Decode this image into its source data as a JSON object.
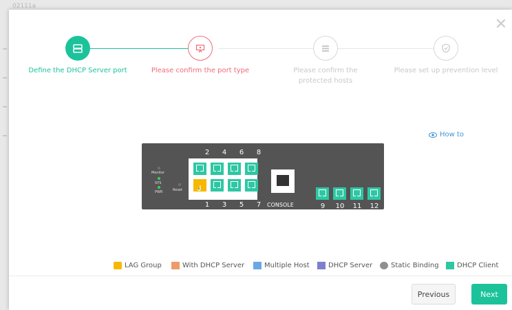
{
  "background": {
    "header_text": "02111a"
  },
  "steps": [
    {
      "label": "Define the DHCP Server port",
      "state": "done",
      "icon": "server-icon"
    },
    {
      "label": "Please confirm the port type",
      "state": "current",
      "icon": "monitor-icon"
    },
    {
      "label": "Please confirm the protected hosts",
      "state": "todo",
      "icon": "list-icon"
    },
    {
      "label": "Please set up prevention level",
      "state": "todo",
      "icon": "shield-icon"
    }
  ],
  "how_to": {
    "label": "How to",
    "icon": "eye-icon"
  },
  "device": {
    "led_labels": {
      "monitor": "Monitor",
      "sys": "SYS",
      "pwr": "PWR",
      "reset": "Reset"
    },
    "top_port_labels": [
      "2",
      "4",
      "6",
      "8"
    ],
    "bottom_port_labels": [
      "1",
      "3",
      "5",
      "7"
    ],
    "console_label": "CONSOLE",
    "sfp_port_labels": [
      "9",
      "10",
      "11",
      "12"
    ],
    "lag_port": "1"
  },
  "legend": [
    {
      "label": "LAG Group",
      "color": "#f7b800"
    },
    {
      "label": "With DHCP Server",
      "color": "#ef9a6a"
    },
    {
      "label": "Multiple Host",
      "color": "#6aa7e6"
    },
    {
      "label": "DHCP Server",
      "color": "#7f7fd0"
    },
    {
      "label": "Static Binding",
      "color": "#8f8f8f"
    },
    {
      "label": "DHCP Client",
      "color": "#2ec7a4"
    }
  ],
  "buttons": {
    "previous": "Previous",
    "next": "Next"
  },
  "colors": {
    "primary": "#1cc39a",
    "current": "#ef6b7a",
    "link": "#3f96d6"
  }
}
